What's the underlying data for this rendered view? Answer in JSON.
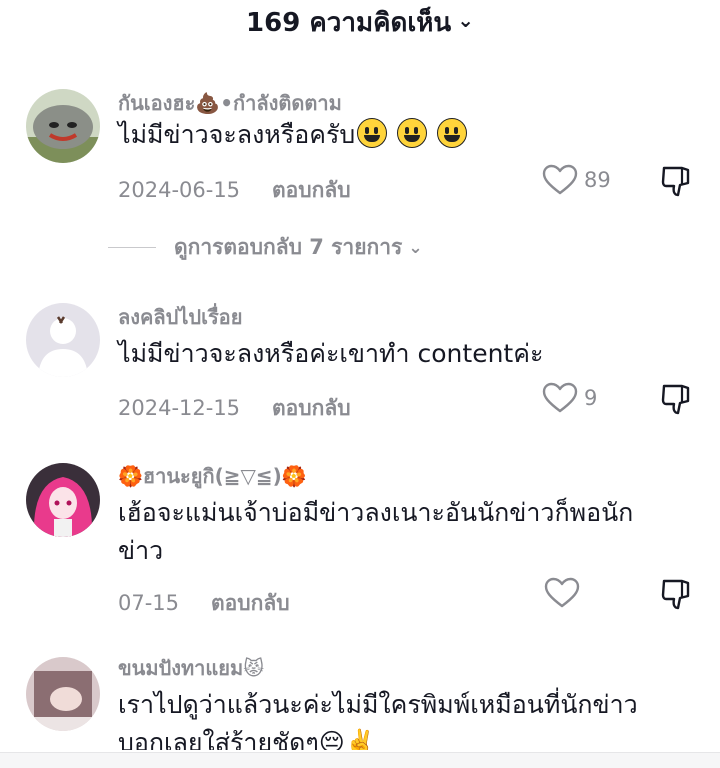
{
  "header": {
    "count_title": "169 ความคิดเห็น",
    "chevron": "⌄"
  },
  "comments": [
    {
      "username": "กันเองฮะ💩•กำลังติดตาม",
      "text": "ไม่มีข่าวจะลงหรือครับ",
      "emoji_count_shown": "😃😃😃",
      "date": "2024-06-15",
      "reply_label": "ตอบกลับ",
      "likes": "89",
      "avatar_color": "#8f9a86"
    },
    {
      "username": "ลงคลิปไปเรื่อย",
      "text": "ไม่มีข่าวจะลงหรือค่ะเขาทำ contentค่ะ",
      "date": "2024-12-15",
      "reply_label": "ตอบกลับ",
      "likes": "9",
      "avatar_color": "#e6e3ea"
    },
    {
      "username": "🏵️ฮานะยูกิ(≧▽≦)🏵️",
      "text": "เฮ้อจะแม่นเจ้าบ่อมีข่าวลงเนาะอันนักข่าวก็พอนักข่าว",
      "date": "07-15",
      "reply_label": "ตอบกลับ",
      "likes": "",
      "avatar_color": "#e93a8c"
    },
    {
      "username": "ขนมปังทาแยม😾",
      "text": "เราไปดูว่าแล้วนะค่ะไม่มีใครพิมพ์เหมือนที่นักข่าวบอกเลยใส่ร้ายชัดๆ😔✌️",
      "avatar_color": "#b79a9e"
    }
  ],
  "view_replies": {
    "label": "ดูการตอบกลับ 7 รายการ",
    "chevron": "⌄"
  },
  "icons": {
    "like": "heart-outline-icon",
    "dislike": "thumbs-down-icon"
  }
}
